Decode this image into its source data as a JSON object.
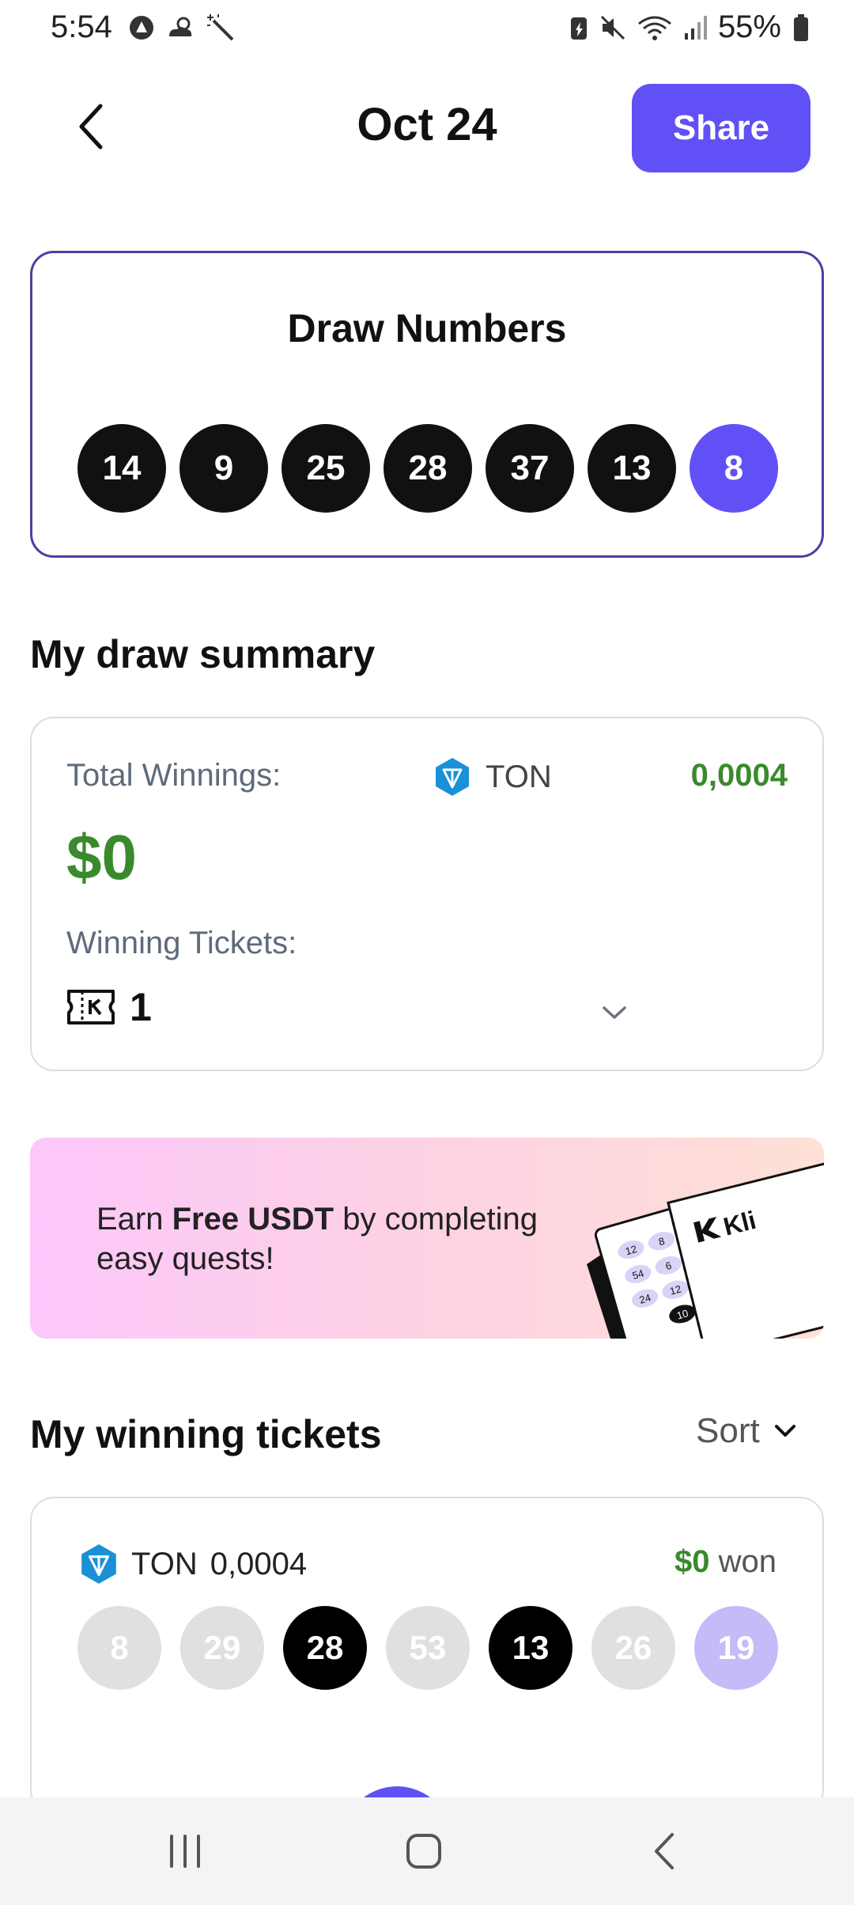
{
  "status_bar": {
    "time": "5:54",
    "battery_pct": "55%",
    "icons": [
      "notification-app-icon",
      "weather-icon",
      "magic-wand-icon",
      "battery-saver-icon",
      "mute-icon",
      "wifi-icon",
      "signal-icon",
      "battery-icon"
    ]
  },
  "header": {
    "title": "Oct 24",
    "share_label": "Share"
  },
  "draw": {
    "title": "Draw Numbers",
    "numbers": [
      "14",
      "9",
      "25",
      "28",
      "37",
      "13"
    ],
    "bonus": "8"
  },
  "summary": {
    "section_title": "My draw summary",
    "total_winnings_label": "Total Winnings:",
    "currency": "TON",
    "currency_amount": "0,0004",
    "total_usd": "$0",
    "winning_tickets_label": "Winning Tickets:",
    "winning_tickets_count": "1"
  },
  "promo": {
    "text_before": "Earn ",
    "text_bold": "Free USDT",
    "text_after": " by completing easy quests!",
    "art_ticket_numbers": [
      "12",
      "8",
      "54",
      "6",
      "24",
      "12",
      "10"
    ],
    "art_brand": "Kli"
  },
  "winning_tickets": {
    "section_title": "My winning tickets",
    "sort_label": "Sort",
    "tickets": [
      {
        "currency": "TON",
        "amount": "0,0004",
        "won_amount": "$0",
        "won_label": "won",
        "numbers": [
          "8",
          "29",
          "28",
          "53",
          "13",
          "26"
        ],
        "bonus": "19",
        "hits": [
          false,
          false,
          true,
          false,
          true,
          false
        ],
        "bonus_hit": false
      }
    ]
  },
  "colors": {
    "accent": "#6150f5",
    "win_green": "#3a8a2d",
    "miss_grey": "#e1e0de",
    "bonus_miss": "#c4bbf8"
  }
}
